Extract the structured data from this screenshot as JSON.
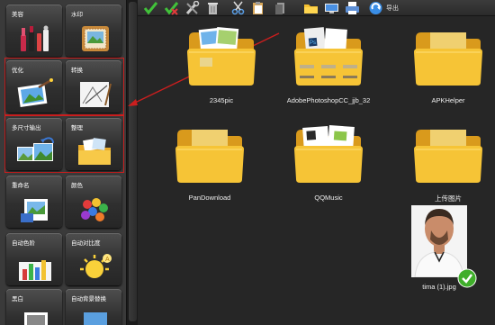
{
  "tools": [
    {
      "key": "beauty",
      "label": "美容"
    },
    {
      "key": "watermark",
      "label": "水印"
    },
    {
      "key": "optimize",
      "label": "优化"
    },
    {
      "key": "convert",
      "label": "转换"
    },
    {
      "key": "multisize",
      "label": "多尺寸输出"
    },
    {
      "key": "organize",
      "label": "整理"
    },
    {
      "key": "rename",
      "label": "重命名"
    },
    {
      "key": "color",
      "label": "颜色"
    },
    {
      "key": "autolevels",
      "label": "自动色阶"
    },
    {
      "key": "autocontrast",
      "label": "自动对比度"
    },
    {
      "key": "blackwhite",
      "label": "黑白"
    },
    {
      "key": "autobg",
      "label": "自动背景替换"
    }
  ],
  "toolbar": {
    "icons": [
      "select-all-icon",
      "deselect-icon",
      "tools-icon",
      "delete-icon",
      "cut-icon",
      "paste-icon",
      "copy-icon",
      "folder-icon",
      "screen-icon",
      "printer-icon",
      "export-icon"
    ],
    "export_label": "导出"
  },
  "files": [
    {
      "name": "2345pic",
      "type": "folder"
    },
    {
      "name": "AdobePhotoshopCC_jjb_32",
      "type": "folder"
    },
    {
      "name": "APKHelper",
      "type": "folder"
    },
    {
      "name": "PanDownload",
      "type": "folder"
    },
    {
      "name": "QQMusic",
      "type": "folder"
    },
    {
      "name": "上传图片",
      "type": "folder"
    },
    {
      "name": "tima (1).jpg",
      "type": "image"
    }
  ],
  "colors": {
    "highlight": "#cc1e1e",
    "folder": "#f6c436",
    "checkmark": "#3fae2a"
  }
}
